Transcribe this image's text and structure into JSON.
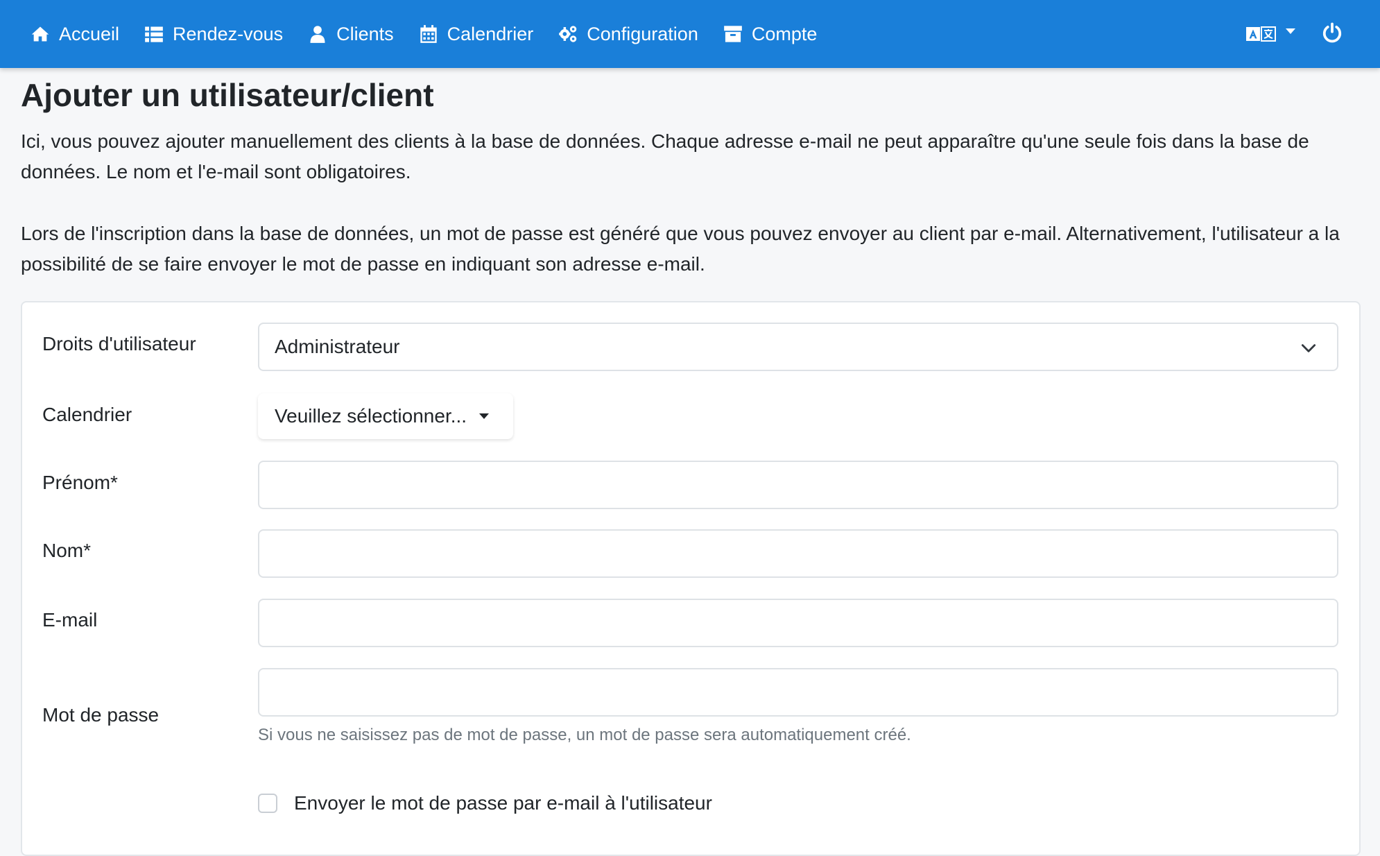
{
  "navbar": {
    "items": [
      {
        "label": "Accueil",
        "icon": "home-icon"
      },
      {
        "label": "Rendez-vous",
        "icon": "list-icon"
      },
      {
        "label": "Clients",
        "icon": "user-icon"
      },
      {
        "label": "Calendrier",
        "icon": "calendar-icon"
      },
      {
        "label": "Configuration",
        "icon": "gears-icon"
      },
      {
        "label": "Compte",
        "icon": "archive-icon"
      }
    ],
    "language_icon": "language-icon",
    "logout_icon": "power-icon",
    "background_color": "#1a7fd9"
  },
  "page": {
    "title": "Ajouter un utilisateur/client",
    "intro_1": "Ici, vous pouvez ajouter manuellement des clients à la base de données. Chaque adresse e-mail ne peut apparaître qu'une seule fois dans la base de données. Le nom et l'e-mail sont obligatoires.",
    "intro_2": "Lors de l'inscription dans la base de données, un mot de passe est généré que vous pouvez envoyer au client par e-mail. Alternativement, l'utilisateur a la possibilité de se faire envoyer le mot de passe en indiquant son adresse e-mail."
  },
  "form": {
    "rights_label": "Droits d'utilisateur",
    "rights_value": "Administrateur",
    "calendar_label": "Calendrier",
    "calendar_value": "Veuillez sélectionner...",
    "firstname_label": "Prénom*",
    "firstname_value": "",
    "lastname_label": "Nom*",
    "lastname_value": "",
    "email_label": "E-mail",
    "email_value": "",
    "password_label": "Mot de passe",
    "password_value": "",
    "password_help": "Si vous ne saisissez pas de mot de passe, un mot de passe sera automatiquement créé.",
    "send_password_label": "Envoyer le mot de passe par e-mail à l'utilisateur",
    "send_password_checked": false
  }
}
